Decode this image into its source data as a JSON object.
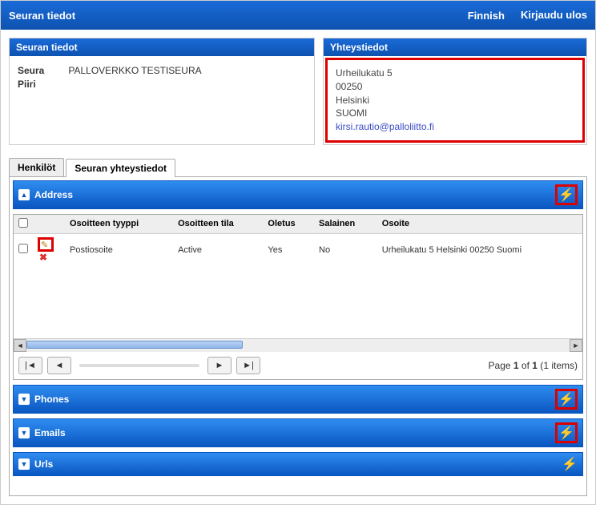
{
  "topbar": {
    "title": "Seuran tiedot",
    "lang": "Finnish",
    "logout": "Kirjaudu ulos"
  },
  "club_panel": {
    "header": "Seuran tiedot",
    "labels": {
      "club": "Seura",
      "district": "Piiri"
    },
    "club_name": "PALLOVERKKO TESTISEURA",
    "district_name": ""
  },
  "contact_panel": {
    "header": "Yhteystiedot",
    "street": "Urheilukatu 5",
    "zip": "00250",
    "city": "Helsinki",
    "country": "SUOMI",
    "email": "kirsi.rautio@palloliitto.fi"
  },
  "tabs": {
    "people": "Henkilöt",
    "contacts": "Seuran yhteystiedot"
  },
  "sections": {
    "address": "Address",
    "phones": "Phones",
    "emails": "Emails",
    "urls": "Urls"
  },
  "grid": {
    "cols": {
      "type": "Osoitteen tyyppi",
      "status": "Osoitteen tila",
      "default": "Oletus",
      "secret": "Salainen",
      "address": "Osoite"
    },
    "rows": [
      {
        "type": "Postiosoite",
        "status": "Active",
        "default": "Yes",
        "secret": "No",
        "address": "Urheilukatu 5 Helsinki 00250 Suomi"
      }
    ]
  },
  "pager": {
    "text_prefix": "Page ",
    "page": "1",
    "of": " of ",
    "total": "1",
    "items_prefix": " (",
    "items": "1 items",
    "items_suffix": ")"
  }
}
